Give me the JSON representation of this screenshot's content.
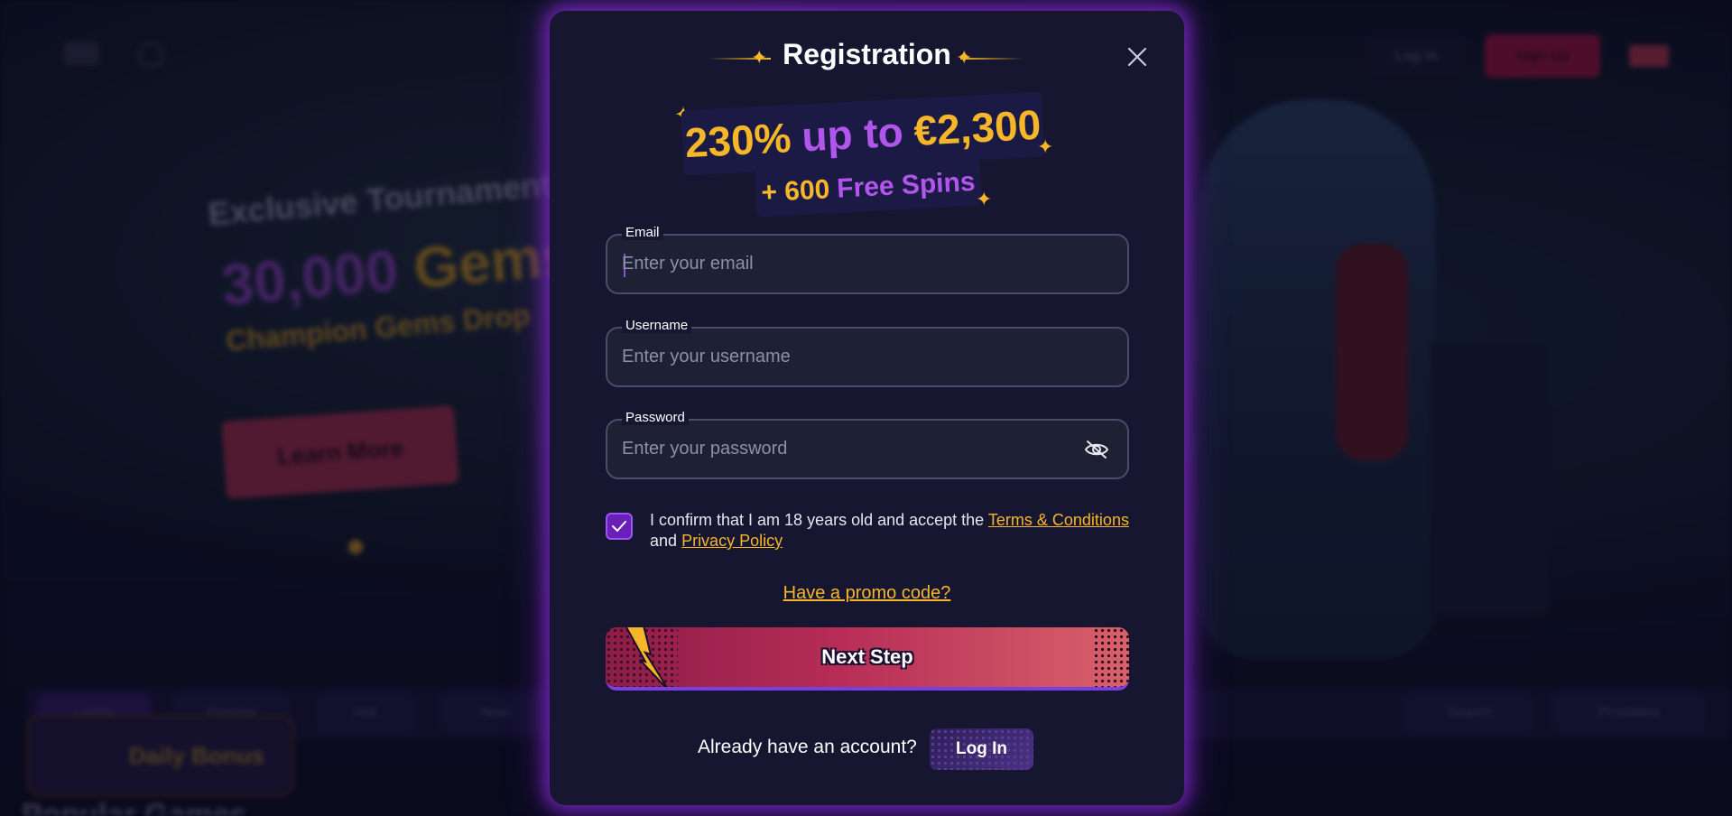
{
  "background": {
    "header": {
      "login_label": "Log In",
      "signup_label": "Sign Up"
    },
    "hero": {
      "kicker": "Exclusive Tournament",
      "amount_number": "30,000",
      "amount_word": "Gems",
      "subtitle": "Champion Gems Drop",
      "cta_label": "Learn More"
    },
    "nav_items": [
      "Lobby",
      "Popular",
      "Hot",
      "New",
      "Search",
      "Providers"
    ],
    "daily_bonus_label": "Daily Bonus",
    "section_title": "Popular Games"
  },
  "modal": {
    "title": "Registration",
    "close_icon": "close-icon",
    "promo": {
      "percent": "230%",
      "connector": "up to",
      "amount": "€2,300",
      "spins_prefix": "+ 600",
      "spins_suffix": "Free Spins"
    },
    "fields": {
      "email": {
        "label": "Email",
        "placeholder": "Enter your email",
        "value": ""
      },
      "username": {
        "label": "Username",
        "placeholder": "Enter your username",
        "value": ""
      },
      "password": {
        "label": "Password",
        "placeholder": "Enter your password",
        "value": "",
        "toggle_icon": "eye-off-icon"
      }
    },
    "terms": {
      "checked": true,
      "text_before": "I confirm that I am 18 years old and accept the",
      "terms_link": "Terms & Conditions",
      "text_middle": "and",
      "privacy_link": "Privacy Policy"
    },
    "promo_code_link": "Have a promo code?",
    "next_button": "Next Step",
    "footer": {
      "prompt": "Already have an account?",
      "login_button": "Log In"
    }
  },
  "colors": {
    "accent_gold": "#f5b629",
    "accent_purple": "#b255ec",
    "primary_button": "#b72d57",
    "modal_bg": "#161630",
    "glow": "#8028c8"
  }
}
